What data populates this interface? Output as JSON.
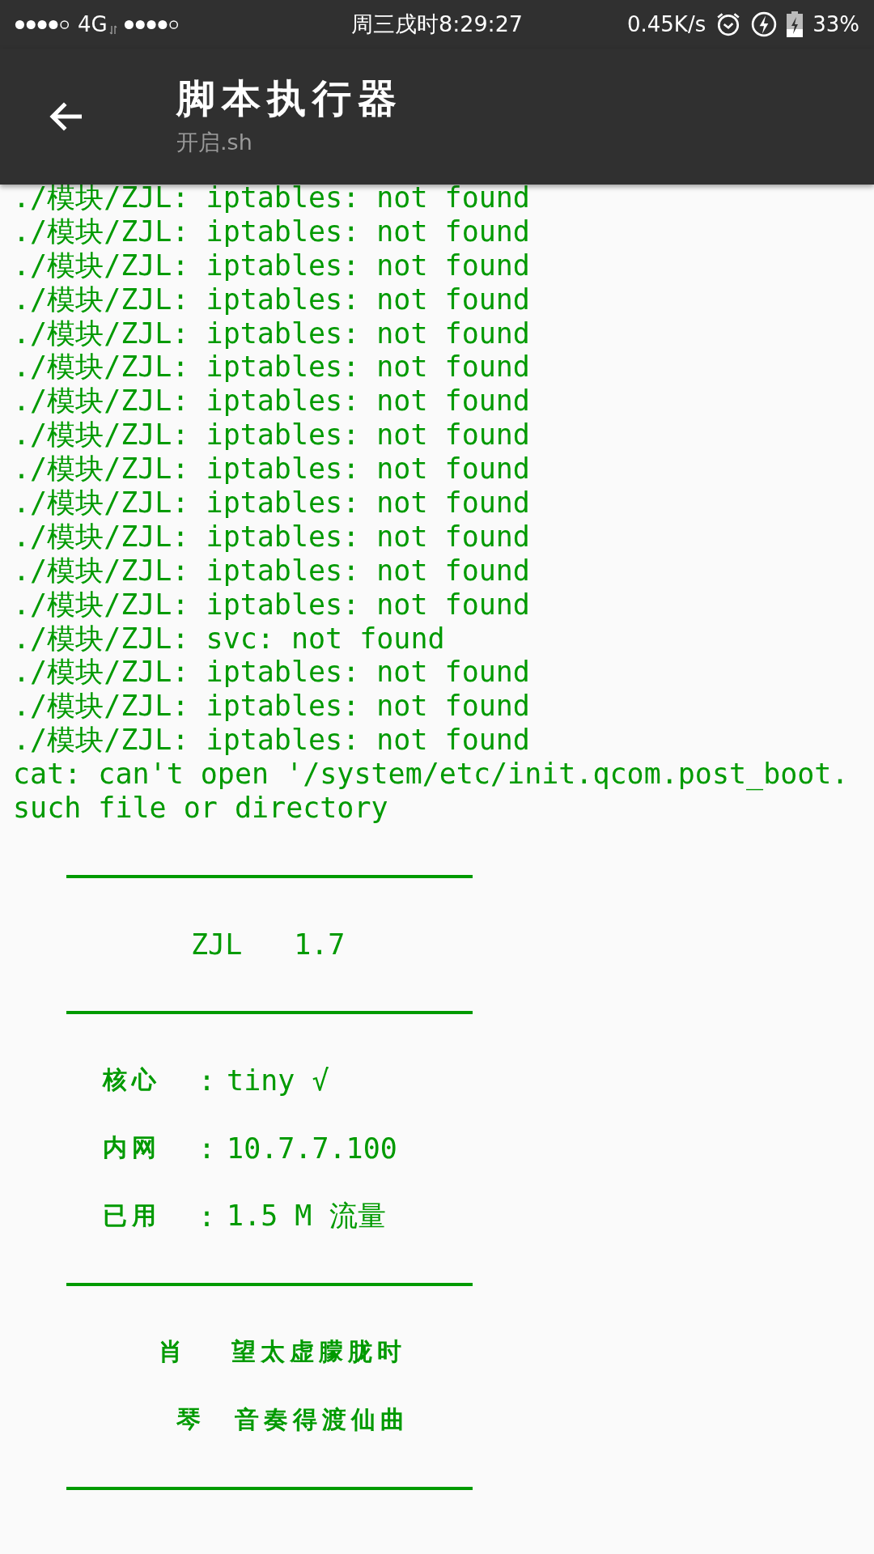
{
  "status_bar": {
    "network": "4G",
    "clock": "周三戌时8:29:27",
    "speed": "0.45K/s",
    "battery": "33%"
  },
  "app_bar": {
    "title": "脚本执行器",
    "subtitle": "开启.sh"
  },
  "log_lines": [
    "./模块/ZJL: iptables: not found",
    "./模块/ZJL: iptables: not found",
    "./模块/ZJL: iptables: not found",
    "./模块/ZJL: iptables: not found",
    "./模块/ZJL: iptables: not found",
    "./模块/ZJL: iptables: not found",
    "./模块/ZJL: iptables: not found",
    "./模块/ZJL: iptables: not found",
    "./模块/ZJL: iptables: not found",
    "./模块/ZJL: iptables: not found",
    "./模块/ZJL: iptables: not found",
    "./模块/ZJL: iptables: not found",
    "./模块/ZJL: iptables: not found",
    "./模块/ZJL: svc: not found",
    "./模块/ZJL: iptables: not found",
    "./模块/ZJL: iptables: not found",
    "./模块/ZJL: iptables: not found",
    "cat: can't open '/system/etc/init.qcom.post_boot.",
    "such file or directory"
  ],
  "heading": {
    "name": "ZJL",
    "version": "1.7"
  },
  "info_rows": [
    {
      "label": "核心",
      "separator": ":",
      "value": "tiny √"
    },
    {
      "label": "内网",
      "separator": ":",
      "value": "10.7.7.100"
    },
    {
      "label": "已用",
      "separator": ":",
      "value": "1.5 M 流量"
    }
  ],
  "verses": [
    {
      "head": "肖",
      "line": "望太虚朦胧时"
    },
    {
      "head": "琴",
      "line": "音奏得渡仙曲"
    }
  ]
}
